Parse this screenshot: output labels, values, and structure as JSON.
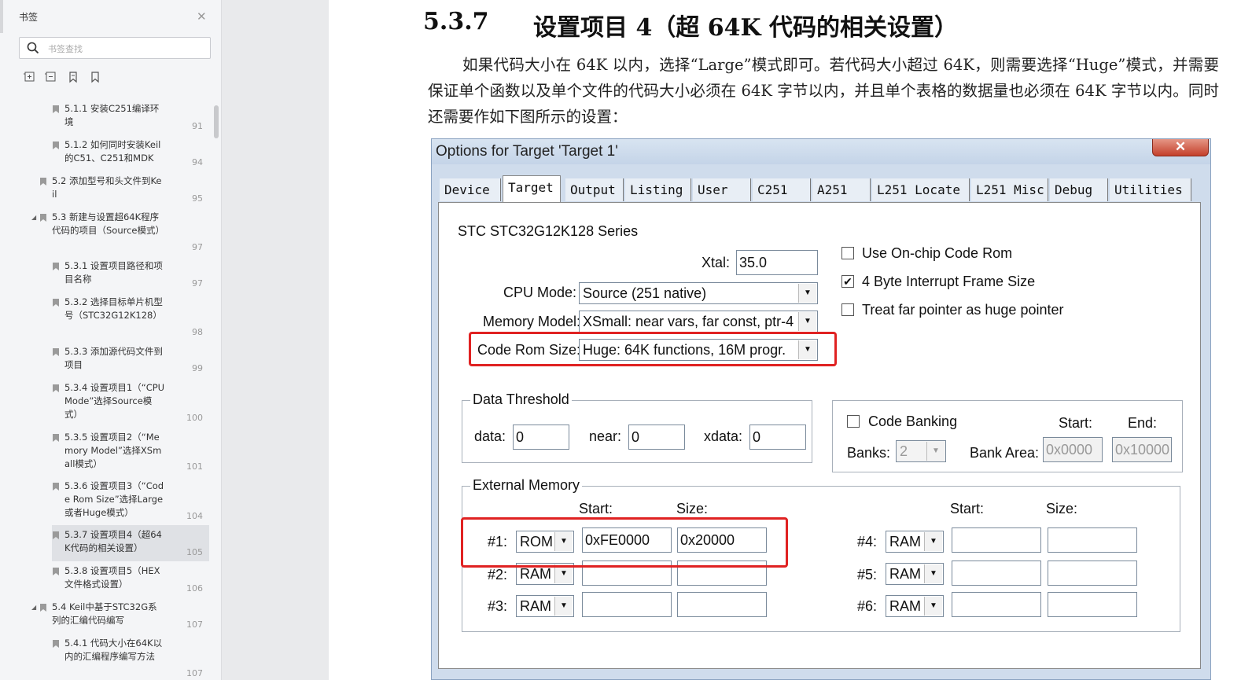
{
  "sidebar": {
    "title": "书签",
    "search_placeholder": "书签查找",
    "bookmarks": [
      {
        "text": "5.1.1 安装C251编译环境",
        "page": "91"
      },
      {
        "text": "5.1.2 如何同时安装Keil的C51、C251和MDK",
        "page": "94"
      },
      {
        "text": "5.2 添加型号和头文件到Keil",
        "page": "95"
      },
      {
        "text": "5.3 新建与设置超64K程序代码的项目（Source模式）",
        "page": "97"
      },
      {
        "text": "5.3.1 设置项目路径和项目名称",
        "page": "97"
      },
      {
        "text": "5.3.2 选择目标单片机型号（STC32G12K128）",
        "page": "98"
      },
      {
        "text": "5.3.3 添加源代码文件到项目",
        "page": "99"
      },
      {
        "text": "5.3.4 设置项目1（“CPU Mode”选择Source模式）",
        "page": "100"
      },
      {
        "text": "5.3.5 设置项目2（“Memory Model”选择XSmall模式）",
        "page": "101"
      },
      {
        "text": "5.3.6 设置项目3（“Code Rom Size”选择Large或者Huge模式）",
        "page": "104"
      },
      {
        "text": "5.3.7 设置项目4（超64K代码的相关设置）",
        "page": "105"
      },
      {
        "text": "5.3.8 设置项目5（HEX文件格式设置）",
        "page": "106"
      },
      {
        "text": "5.4 Keil中基于STC32G系列的汇编代码编写",
        "page": "107"
      },
      {
        "text": "5.4.1 代码大小在64K以内的汇编程序编写方法",
        "page": "107"
      }
    ]
  },
  "document": {
    "heading_number": "5.3.7",
    "heading_text": "设置项目 4（超 64K 代码的相关设置）",
    "paragraph": "如果代码大小在 64K 以内，选择“Large”模式即可。若代码大小超过 64K，则需要选择“Huge”模式，并需要保证单个函数以及单个文件的代码大小必须在 64K 字节以内，并且单个表格的数据量也必须在 64K 字节以内。同时还需要作如下图所示的设置："
  },
  "dialog": {
    "title": "Options for Target 'Target 1'",
    "close_glyph": "✕",
    "tabs": [
      "Device",
      "Target",
      "Output",
      "Listing",
      "User",
      "C251",
      "A251",
      "L251 Locate",
      "L251 Misc",
      "Debug",
      "Utilities"
    ],
    "active_tab": "Target",
    "device_name": "STC STC32G12K128 Series",
    "xtal_label": "Xtal:",
    "xtal_value": "35.0",
    "cpu_mode_label": "CPU Mode:",
    "cpu_mode_value": "Source (251 native)",
    "memory_model_label": "Memory Model:",
    "memory_model_value": "XSmall: near vars, far const, ptr-4",
    "code_rom_label": "Code Rom Size:",
    "code_rom_value": "Huge: 64K functions, 16M progr.",
    "check_onchip": "Use On-chip Code Rom",
    "check_4byte": "4 Byte Interrupt Frame Size",
    "check_far": "Treat far pointer as huge pointer",
    "checks_state": [
      false,
      true,
      false
    ],
    "data_threshold": {
      "title": "Data Threshold",
      "data_label": "data:",
      "data_value": "0",
      "near_label": "near:",
      "near_value": "0",
      "xdata_label": "xdata:",
      "xdata_value": "0"
    },
    "banking": {
      "check_label": "Code Banking",
      "checked": false,
      "start_label": "Start:",
      "end_label": "End:",
      "banks_label": "Banks:",
      "banks_value": "2",
      "bank_area_label": "Bank Area:",
      "start_value": "0x0000",
      "end_value": "0x10000"
    },
    "external_memory": {
      "title": "External Memory",
      "start_label": "Start:",
      "size_label": "Size:",
      "rows": [
        {
          "label": "#1:",
          "type": "ROM",
          "start": "0xFE0000",
          "size": "0x20000"
        },
        {
          "label": "#2:",
          "type": "RAM",
          "start": "",
          "size": ""
        },
        {
          "label": "#3:",
          "type": "RAM",
          "start": "",
          "size": ""
        },
        {
          "label": "#4:",
          "type": "RAM",
          "start": "",
          "size": ""
        },
        {
          "label": "#5:",
          "type": "RAM",
          "start": "",
          "size": ""
        },
        {
          "label": "#6:",
          "type": "RAM",
          "start": "",
          "size": ""
        }
      ]
    },
    "highlight_color": "#e02222"
  }
}
